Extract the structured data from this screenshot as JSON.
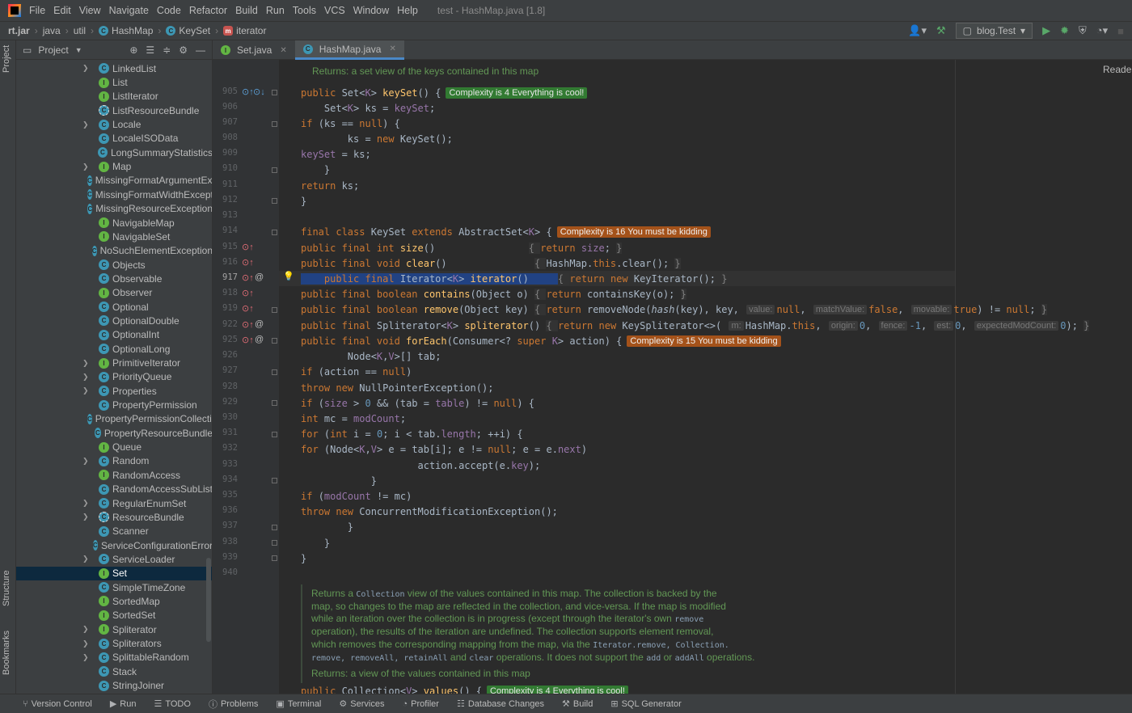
{
  "menubar": {
    "items": [
      "File",
      "Edit",
      "View",
      "Navigate",
      "Code",
      "Refactor",
      "Build",
      "Run",
      "Tools",
      "VCS",
      "Window",
      "Help"
    ],
    "window_title": "test - HashMap.java [1.8]"
  },
  "breadcrumbs": [
    "rt.jar",
    "java",
    "util",
    "HashMap",
    "KeySet",
    "iterator"
  ],
  "toolbar": {
    "run_config": "blog.Test"
  },
  "left_stripe": {
    "project": "Project",
    "structure": "Structure",
    "bookmarks": "Bookmarks"
  },
  "project_panel": {
    "title": "Project",
    "items": [
      {
        "label": "LinkedList",
        "kind": "class",
        "expandable": true
      },
      {
        "label": "List",
        "kind": "interface",
        "expandable": false
      },
      {
        "label": "ListIterator",
        "kind": "interface",
        "expandable": false
      },
      {
        "label": "ListResourceBundle",
        "kind": "abstract",
        "expandable": false
      },
      {
        "label": "Locale",
        "kind": "class",
        "expandable": true
      },
      {
        "label": "LocaleISOData",
        "kind": "class",
        "expandable": false
      },
      {
        "label": "LongSummaryStatistics",
        "kind": "class",
        "expandable": false
      },
      {
        "label": "Map",
        "kind": "interface",
        "expandable": true
      },
      {
        "label": "MissingFormatArgumentException",
        "kind": "class",
        "expandable": false
      },
      {
        "label": "MissingFormatWidthException",
        "kind": "class",
        "expandable": false
      },
      {
        "label": "MissingResourceException",
        "kind": "class",
        "expandable": false
      },
      {
        "label": "NavigableMap",
        "kind": "interface",
        "expandable": false
      },
      {
        "label": "NavigableSet",
        "kind": "interface",
        "expandable": false
      },
      {
        "label": "NoSuchElementException",
        "kind": "class",
        "expandable": false
      },
      {
        "label": "Objects",
        "kind": "class",
        "expandable": false
      },
      {
        "label": "Observable",
        "kind": "class",
        "expandable": false
      },
      {
        "label": "Observer",
        "kind": "interface",
        "expandable": false
      },
      {
        "label": "Optional",
        "kind": "class",
        "expandable": false
      },
      {
        "label": "OptionalDouble",
        "kind": "class",
        "expandable": false
      },
      {
        "label": "OptionalInt",
        "kind": "class",
        "expandable": false
      },
      {
        "label": "OptionalLong",
        "kind": "class",
        "expandable": false
      },
      {
        "label": "PrimitiveIterator",
        "kind": "interface",
        "expandable": true
      },
      {
        "label": "PriorityQueue",
        "kind": "class",
        "expandable": true
      },
      {
        "label": "Properties",
        "kind": "class",
        "expandable": true
      },
      {
        "label": "PropertyPermission",
        "kind": "class",
        "expandable": false
      },
      {
        "label": "PropertyPermissionCollection",
        "kind": "class",
        "expandable": false
      },
      {
        "label": "PropertyResourceBundle",
        "kind": "class",
        "expandable": false
      },
      {
        "label": "Queue",
        "kind": "interface",
        "expandable": false
      },
      {
        "label": "Random",
        "kind": "class",
        "expandable": true
      },
      {
        "label": "RandomAccess",
        "kind": "interface",
        "expandable": false
      },
      {
        "label": "RandomAccessSubList",
        "kind": "class",
        "expandable": false
      },
      {
        "label": "RegularEnumSet",
        "kind": "class",
        "expandable": true
      },
      {
        "label": "ResourceBundle",
        "kind": "abstract",
        "expandable": true
      },
      {
        "label": "Scanner",
        "kind": "class",
        "expandable": false
      },
      {
        "label": "ServiceConfigurationError",
        "kind": "class",
        "expandable": false
      },
      {
        "label": "ServiceLoader",
        "kind": "class",
        "expandable": true
      },
      {
        "label": "Set",
        "kind": "interface",
        "expandable": false,
        "selected": true
      },
      {
        "label": "SimpleTimeZone",
        "kind": "class",
        "expandable": false
      },
      {
        "label": "SortedMap",
        "kind": "interface",
        "expandable": false
      },
      {
        "label": "SortedSet",
        "kind": "interface",
        "expandable": false
      },
      {
        "label": "Spliterator",
        "kind": "interface",
        "expandable": true
      },
      {
        "label": "Spliterators",
        "kind": "class",
        "expandable": true
      },
      {
        "label": "SplittableRandom",
        "kind": "class",
        "expandable": true
      },
      {
        "label": "Stack",
        "kind": "class",
        "expandable": false
      },
      {
        "label": "StringJoiner",
        "kind": "class",
        "expandable": false
      }
    ]
  },
  "editor_tabs": [
    {
      "label": "Set.java",
      "kind": "interface",
      "active": false
    },
    {
      "label": "HashMap.java",
      "kind": "class",
      "active": true
    }
  ],
  "reader_mode": "Reader",
  "line_numbers": [
    "905",
    "906",
    "907",
    "908",
    "909",
    "910",
    "911",
    "912",
    "913",
    "914",
    "915",
    "916",
    "917",
    "918",
    "919",
    "922",
    "925",
    "926",
    "927",
    "928",
    "929",
    "930",
    "931",
    "932",
    "933",
    "934",
    "935",
    "936",
    "937",
    "938",
    "939",
    "940"
  ],
  "doc_top": "Returns: a set view of the keys contained in this map",
  "badges": {
    "keyset_method": "Complexity is 4 Everything is cool!",
    "keyset_class": "Complexity is 16 You must be kidding",
    "foreach": "Complexity is 15 You must be kidding",
    "values_partial": "Complexity is 4 Everything is cool!"
  },
  "hints": {
    "value": "value:",
    "matchValue": "matchValue:",
    "movable": "movable:",
    "m": "m:",
    "origin": "origin:",
    "fence": "fence:",
    "est": "est:",
    "expectedModCount": "expectedModCount:"
  },
  "doc_bottom": {
    "lines": [
      [
        "Returns a ",
        "Collection",
        " view of the values contained in this map. The collection is backed by the"
      ],
      [
        "map, so changes to the map are reflected in the collection, and vice-versa. If the map is modified"
      ],
      [
        "while an iteration over the collection is in progress (except through the iterator's own ",
        "remove",
        ""
      ],
      [
        "operation), the results of the iteration are undefined. The collection supports element removal,"
      ],
      [
        "which removes the corresponding mapping from the map, via the ",
        "Iterator.remove, Collection.",
        ""
      ],
      [
        "",
        "remove, removeAll, retainAll",
        " and ",
        "clear",
        " operations. It does not support the ",
        "add",
        " or ",
        "addAll",
        " operations."
      ]
    ],
    "returns": "Returns: a view of the values contained in this map"
  },
  "bottom_tools": [
    "Version Control",
    "Run",
    "TODO",
    "Problems",
    "Terminal",
    "Services",
    "Profiler",
    "Database Changes",
    "Build",
    "SQL Generator"
  ],
  "colors": {
    "background": "#2b2b2b",
    "panel": "#3c3f41",
    "keyword": "#cc7832",
    "function": "#ffc66d",
    "field": "#9876aa",
    "number": "#6897bb",
    "doc": "#629755",
    "selection": "#214283",
    "badge_green": "#327a32",
    "badge_orange": "#a4521a"
  }
}
